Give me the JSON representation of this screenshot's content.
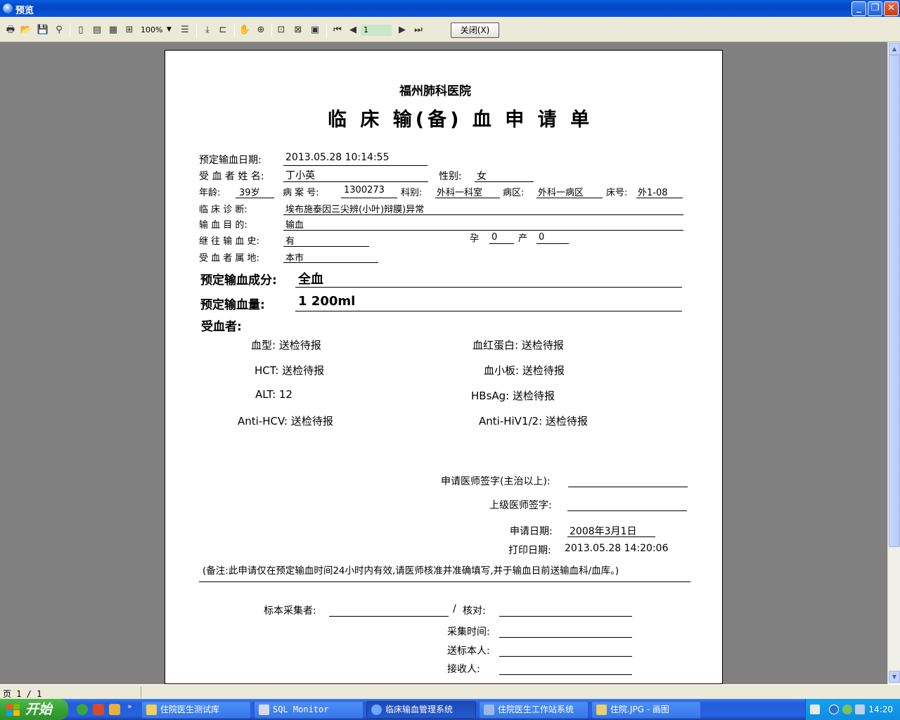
{
  "window": {
    "title": "预览"
  },
  "toolbar": {
    "zoom": "100%",
    "page_input": "1",
    "close_label": "关闭(X)"
  },
  "hospital": "福州肺科医院",
  "form_title": "临 床 输(备) 血 申 请 单",
  "fields": {
    "date_label": "预定输血日期:",
    "date_value": "2013.05.28 10:14:55",
    "name_label": "受 血 者 姓 名:",
    "name_value": "丁小英",
    "sex_label": "性别:",
    "sex_value": "女",
    "age_label": "年龄:",
    "age_value": "39岁",
    "case_label": "病 案 号:",
    "case_value": "1300273",
    "dept_label": "科别:",
    "dept_value": "外科一科室",
    "ward_label": "病区:",
    "ward_value": "外科一病区",
    "bed_label": "床号:",
    "bed_value": "外1-08",
    "diag_label": "临 床 诊 断:",
    "diag_value": "埃布施泰因三尖辨(小叶)辩膜)异常",
    "purpose_label": "输 血 目 的:",
    "purpose_value": "输血",
    "history_label": "继 往 输 血 史:",
    "history_value": "有",
    "preg_label": "孕",
    "preg_value": "0",
    "birth_label": "产",
    "birth_value": "0",
    "address_label": "受 血 者 属 地:",
    "address_value": "本市",
    "component_label": "预定输血成分:",
    "component_value": "全血",
    "volume_label": "预定输血量:",
    "volume_value": "1 200ml",
    "recipient_label": "受血者:"
  },
  "labs": [
    {
      "text": "血型: 送检待报"
    },
    {
      "text": "血红蛋白: 送检待报"
    },
    {
      "text": "HCT: 送检待报"
    },
    {
      "text": "血小板: 送检待报"
    },
    {
      "text": "ALT:  12"
    },
    {
      "text": "HBsAg: 送检待报"
    },
    {
      "text": "Anti-HCV: 送检待报"
    },
    {
      "text": "Anti-HiV1/2: 送检待报"
    }
  ],
  "signatures": {
    "doctor_label": "申请医师签字(主治以上):",
    "senior_label": "上级医师签字:",
    "apply_date_label": "申请日期:",
    "apply_date_value": "2008年3月1日",
    "print_date_label": "打印日期:",
    "print_date_value": "2013.05.28 14:20:06"
  },
  "note": "(备注:此申请仅在预定输血时间24小时内有效,请医师核准并准确填写,并于输血日前送输血科/血库。)",
  "specimen": {
    "collector_label": "标本采集者:",
    "slash": "/",
    "check_label": "核对:",
    "time_label": "采集时间:",
    "sender_label": "送标本人:",
    "receiver_label": "接收人:"
  },
  "status": {
    "page": "页 1 / 1"
  },
  "taskbar": {
    "start": "开始",
    "tasks": [
      {
        "label": "住院医生测试库"
      },
      {
        "label": "SQL Monitor"
      },
      {
        "label": "临床输血管理系统"
      },
      {
        "label": "住院医生工作站系统"
      },
      {
        "label": "住院.JPG - 画图"
      }
    ],
    "clock": "14:20"
  },
  "colors": {
    "titlebar": "#0a5fe0",
    "taskbar": "#245edb",
    "start": "#37a334",
    "workspace": "#808080"
  }
}
